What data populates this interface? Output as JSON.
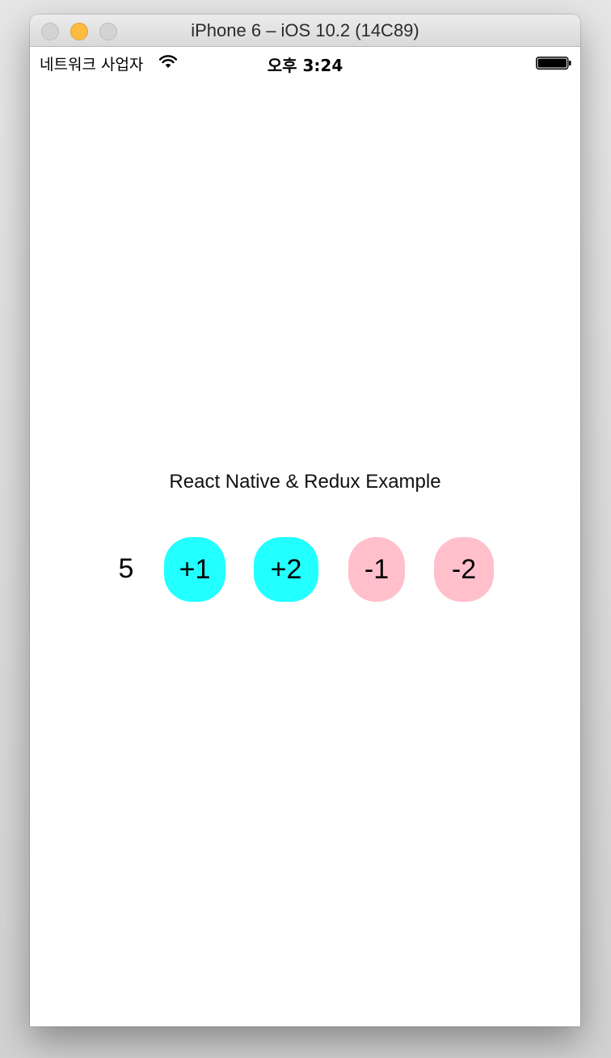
{
  "window": {
    "title": "iPhone 6 – iOS 10.2 (14C89)"
  },
  "status_bar": {
    "carrier": "네트워크 사업자",
    "time": "오후 3:24",
    "wifi_icon": "wifi-icon",
    "battery_icon": "battery-full-icon"
  },
  "app": {
    "title": "React Native & Redux Example",
    "counter_value": "5",
    "buttons": [
      {
        "label": "+1",
        "color": "#22FFFF"
      },
      {
        "label": "+2",
        "color": "#22FFFF"
      },
      {
        "label": "-1",
        "color": "#FFC0CB"
      },
      {
        "label": "-2",
        "color": "#FFC0CB"
      }
    ]
  },
  "colors": {
    "increment_button": "#22FFFF",
    "decrement_button": "#FFC0CB",
    "traffic_minimize": "#FDBC40",
    "traffic_inactive": "#D3D3D3"
  }
}
